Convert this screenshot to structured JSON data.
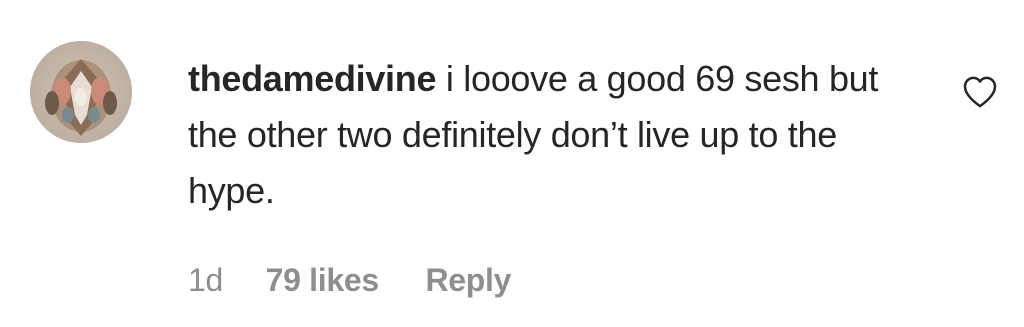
{
  "comment": {
    "username": "thedamedivine",
    "text": "i looove a good 69 sesh but the other two definitely don’t live up to the hype.",
    "time": "1d",
    "likes": "79 likes",
    "reply_label": "Reply",
    "like_icon": "heart-outline-icon",
    "avatar": "profile-avatar"
  }
}
